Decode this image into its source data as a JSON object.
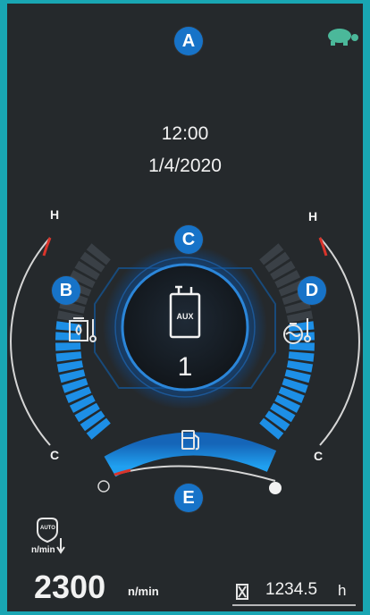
{
  "markers": {
    "a": "A",
    "b": "B",
    "c": "C",
    "d": "D",
    "e": "E"
  },
  "clock": {
    "time": "12:00",
    "date": "1/4/2020"
  },
  "left_gauge": {
    "hot_label": "H",
    "cold_label": "C",
    "level_fraction": 0.6,
    "icon": "hydraulic-oil-temperature-icon"
  },
  "right_gauge": {
    "hot_label": "H",
    "cold_label": "C",
    "level_fraction": 0.6,
    "icon": "coolant-temperature-icon"
  },
  "center": {
    "aux_label": "AUX",
    "aux_number": "1",
    "icon": "aux-attachment-icon"
  },
  "fuel": {
    "level_fraction": 0.92,
    "icon": "fuel-pump-icon"
  },
  "engine": {
    "auto_label": "AUTO",
    "unit_small": "n/min",
    "rpm": "2300",
    "rpm_unit": "n/min"
  },
  "hours": {
    "value": "1234.5",
    "unit": "h",
    "icon": "hourglass-icon"
  },
  "mode_icon": "turtle-icon",
  "colors": {
    "accent": "#1773c8",
    "segment": "#1d8fe6",
    "warn": "#d9342b",
    "background": "#25292c",
    "frame": "#19a6b3"
  }
}
